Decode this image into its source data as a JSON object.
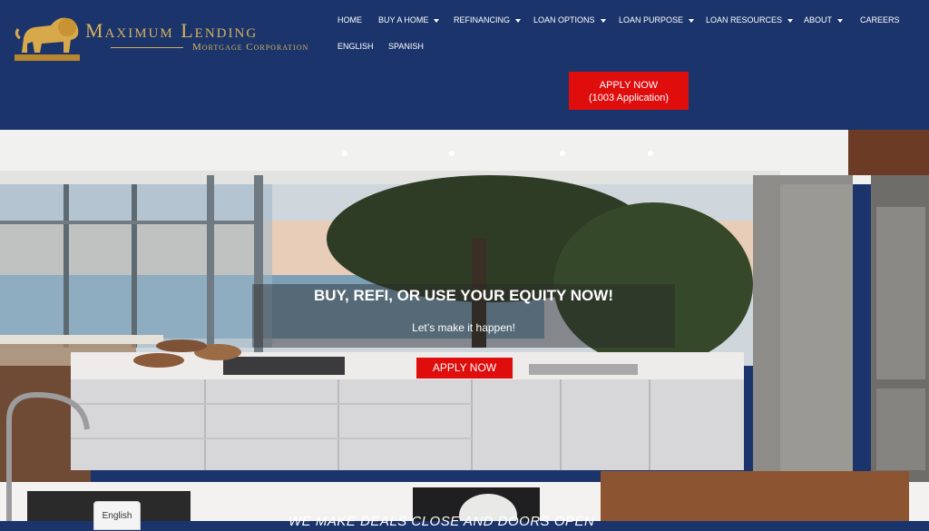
{
  "brand": {
    "name": "Maximum Lending",
    "subtitle": "Mortgage Corporation"
  },
  "nav": {
    "items": [
      {
        "label": "HOME",
        "has_caret": false
      },
      {
        "label": "BUY A HOME",
        "has_caret": true
      },
      {
        "label": "REFINANCING",
        "has_caret": true
      },
      {
        "label": "LOAN OPTIONS",
        "has_caret": true
      },
      {
        "label": "LOAN PURPOSE",
        "has_caret": true
      },
      {
        "label": "LOAN RESOURCES",
        "has_caret": true
      },
      {
        "label": "ABOUT",
        "has_caret": true
      },
      {
        "label": "CAREERS",
        "has_caret": false
      },
      {
        "label": "ENGLISH",
        "has_caret": false
      },
      {
        "label": "SPANISH",
        "has_caret": false
      }
    ]
  },
  "apply_top": {
    "line1": "APPLY NOW",
    "line2": "(1003 Application)"
  },
  "hero": {
    "headline": "BUY, REFI, OR USE YOUR EQUITY NOW!",
    "subline": "Let’s make it happen!",
    "button_label": "APPLY NOW"
  },
  "footer": {
    "tagline": "WE MAKE DEALS CLOSE AND DOORS OPEN"
  },
  "language_widget": {
    "label": "English"
  },
  "colors": {
    "header_bg": "#1b356c",
    "accent_red": "#e00d0d",
    "gold": "#d8b15a"
  }
}
